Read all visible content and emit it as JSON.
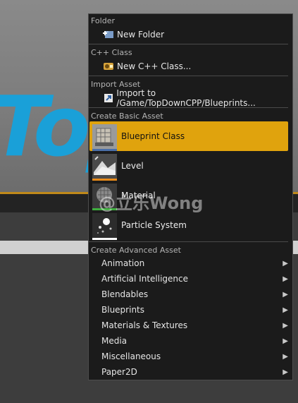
{
  "background": {
    "viewport_text": "Top"
  },
  "menu": {
    "folder": {
      "header": "Folder",
      "new_folder": "New Folder"
    },
    "cpp": {
      "header": "C++ Class",
      "new_class": "New C++ Class..."
    },
    "import": {
      "header": "Import Asset",
      "import_to": "Import to /Game/TopDownCPP/Blueprints..."
    },
    "basic": {
      "header": "Create Basic Asset",
      "items": [
        {
          "label": "Blueprint Class",
          "icon": "blueprint-class-icon",
          "accent": "#e0a30d",
          "selected": true
        },
        {
          "label": "Level",
          "icon": "level-icon",
          "accent": "#e88a1a"
        },
        {
          "label": "Material",
          "icon": "material-icon",
          "accent": "#3fae3f"
        },
        {
          "label": "Particle System",
          "icon": "particle-system-icon",
          "accent": "#ffffff"
        }
      ]
    },
    "advanced": {
      "header": "Create Advanced Asset",
      "items": [
        "Animation",
        "Artificial Intelligence",
        "Blendables",
        "Blueprints",
        "Materials & Textures",
        "Media",
        "Miscellaneous",
        "Paper2D"
      ]
    }
  },
  "watermark": "@立乐Wong"
}
